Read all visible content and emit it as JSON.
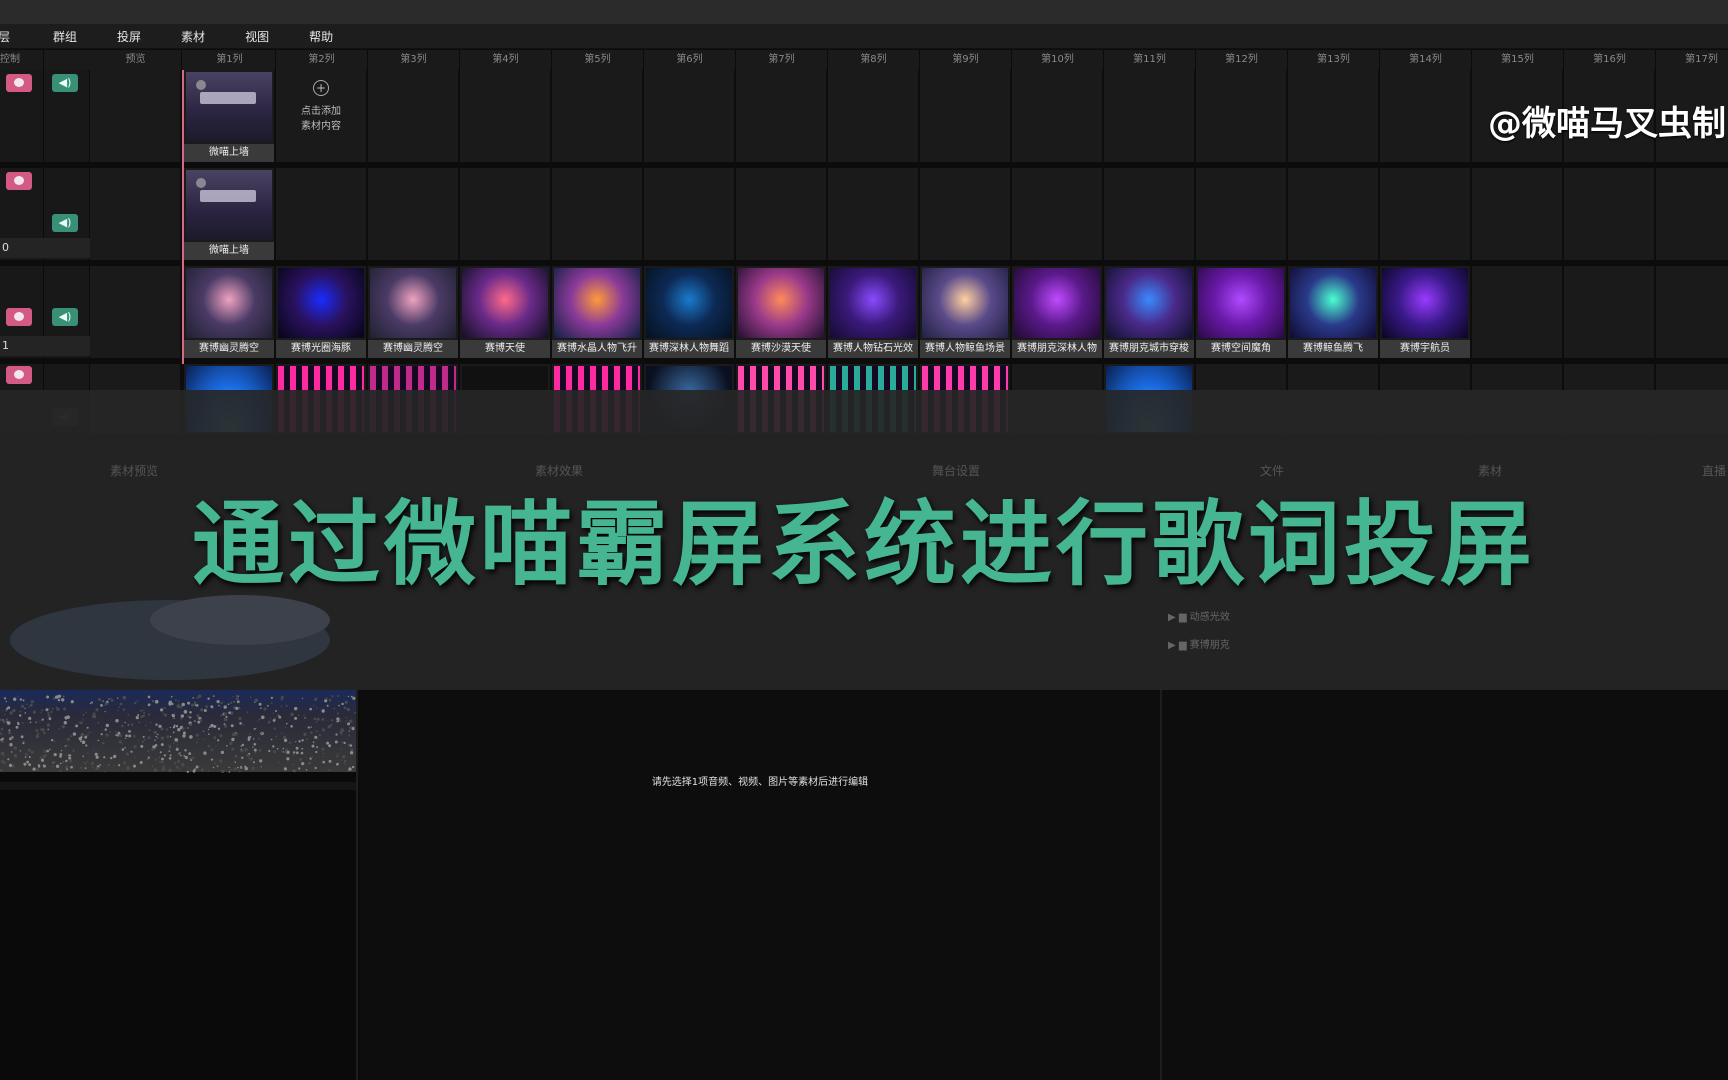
{
  "menu": [
    "层",
    "群组",
    "投屏",
    "素材",
    "视图",
    "帮助"
  ],
  "column_headers": [
    "控制",
    "预览",
    "第1列",
    "第2列",
    "第3列",
    "第4列",
    "第5列",
    "第6列",
    "第7列",
    "第8列",
    "第9列",
    "第10列",
    "第11列",
    "第12列",
    "第13列",
    "第14列",
    "第15列",
    "第16列",
    "第17列"
  ],
  "watermark": "@微喵马叉虫制",
  "rows": {
    "row1": {
      "clips": [
        {
          "label": "微喵上墙"
        }
      ],
      "add_label_1": "点击添加",
      "add_label_2": "素材内容"
    },
    "row2": {
      "info": "0",
      "clips": [
        {
          "label": "微喵上墙"
        }
      ]
    },
    "row3": {
      "info": "1",
      "clips": [
        {
          "label": "赛博幽灵腾空"
        },
        {
          "label": "赛博光圈海豚"
        },
        {
          "label": "赛博幽灵腾空"
        },
        {
          "label": "赛博天使"
        },
        {
          "label": "赛博水晶人物飞升"
        },
        {
          "label": "赛博深林人物舞蹈"
        },
        {
          "label": "赛博沙漠天使"
        },
        {
          "label": "赛博人物钻石光效"
        },
        {
          "label": "赛博人物鲸鱼场景"
        },
        {
          "label": "赛博朋克深林人物"
        },
        {
          "label": "赛博朋克城市穿梭"
        },
        {
          "label": "赛博空间魔角"
        },
        {
          "label": "赛博鲸鱼腾飞"
        },
        {
          "label": "赛博宇航员"
        }
      ]
    }
  },
  "panel_tabs": [
    "素材预览",
    "素材效果",
    "舞台设置",
    "文件",
    "素材",
    "直播"
  ],
  "overlay_title": "通过微喵霸屏系统进行歌词投屏",
  "edit_hint": "请先选择1项音频、视频、图片等素材后进行编辑",
  "folders": [
    "动感光效",
    "赛博朋克"
  ],
  "colors": {
    "title": "#45b592",
    "mute_btn": "#d45a86",
    "audio_btn": "#3a8f77"
  }
}
